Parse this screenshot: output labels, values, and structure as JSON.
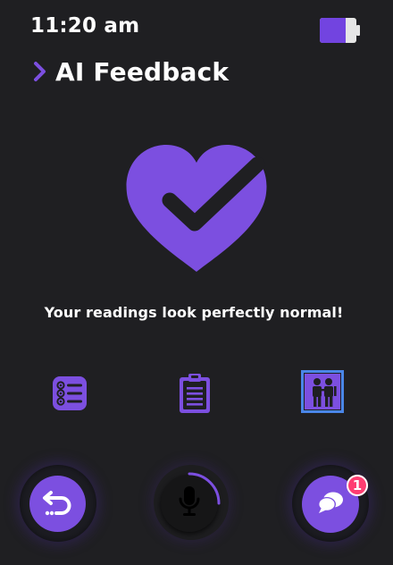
{
  "status_bar": {
    "time": "11:20 am",
    "battery_icon": "battery-icon"
  },
  "header": {
    "title": "AI Feedback",
    "icon": "chevron-right-icon"
  },
  "hero": {
    "icon": "heart-check-icon",
    "message": "Your readings look perfectly normal!"
  },
  "actions": [
    {
      "name": "list",
      "icon": "checklist-icon"
    },
    {
      "name": "clipboard",
      "icon": "clipboard-icon"
    },
    {
      "name": "family",
      "icon": "family-icon"
    }
  ],
  "bottom_bar": {
    "back_icon": "undo-icon",
    "mic_icon": "microphone-icon",
    "chat_icon": "chat-bubbles-icon",
    "chat_badge": "1"
  },
  "colors": {
    "background": "#1f1f22",
    "accent": "#7c4fe0",
    "badge": "#ff3d72",
    "selection": "#4a86e8"
  }
}
